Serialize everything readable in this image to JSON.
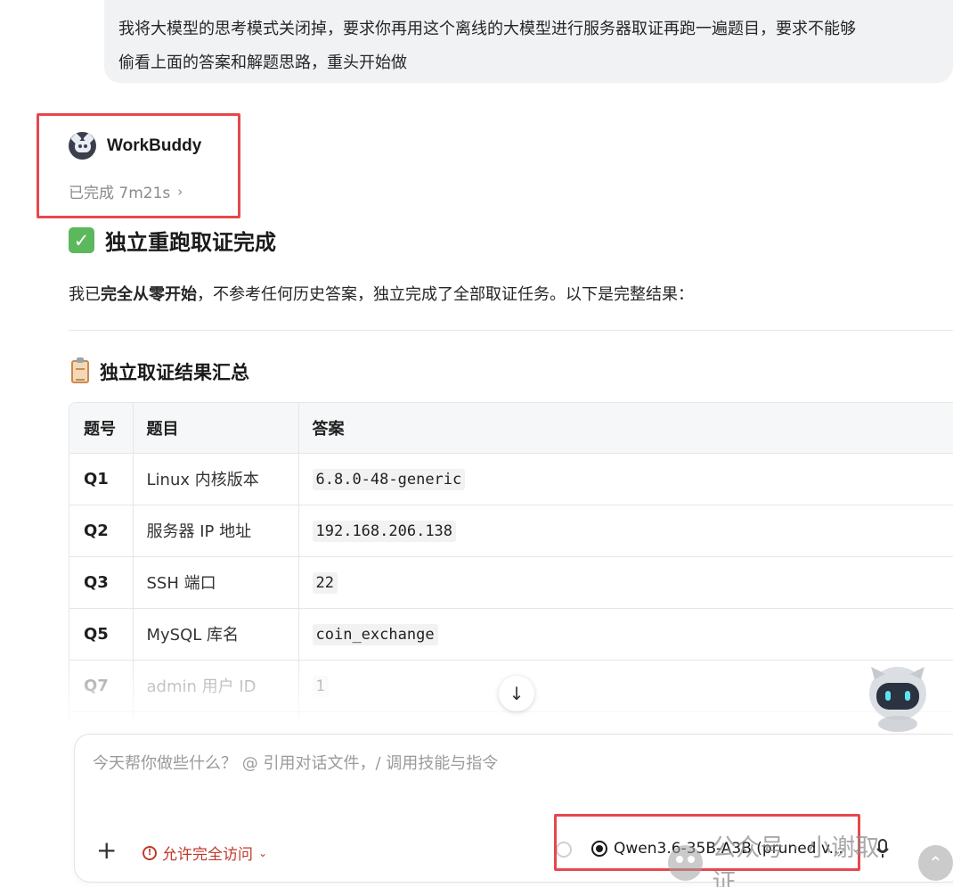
{
  "user_message": {
    "line1": "我将大模型的思考模式关闭掉，要求你再用这个离线的大模型进行服务器取证再跑一遍题目，要求不能够",
    "line2": "偷看上面的答案和解题思路，重头开始做"
  },
  "agent": {
    "name": "WorkBuddy",
    "status": "已完成 7m21s",
    "status_chevron": "›"
  },
  "response": {
    "heading": "独立重跑取证完成",
    "heading_icon": "check-mark-icon",
    "intro_prefix": "我已",
    "intro_bold": "完全从零开始",
    "intro_suffix": "，不参考任何历史答案，独立完成了全部取证任务。以下是完整结果：",
    "section_heading": "独立取证结果汇总",
    "section_icon": "clipboard-icon"
  },
  "table": {
    "headers": [
      "题号",
      "题目",
      "答案"
    ],
    "rows": [
      {
        "id": "Q1",
        "question": "Linux 内核版本",
        "answer": "6.8.0-48-generic"
      },
      {
        "id": "Q2",
        "question": "服务器 IP 地址",
        "answer": "192.168.206.138"
      },
      {
        "id": "Q3",
        "question": "SSH 端口",
        "answer": "22"
      },
      {
        "id": "Q5",
        "question": "MySQL 库名",
        "answer": "coin_exchange"
      },
      {
        "id": "Q7",
        "question": "admin 用户 ID",
        "answer": "1"
      }
    ]
  },
  "scroll_button": {
    "icon": "↓"
  },
  "composer": {
    "placeholder": "今天帮你做些什么？ @ 引用对话文件，/ 调用技能与指令",
    "add_icon": "+",
    "access_label": "允许完全访问",
    "access_chevron": "⌄",
    "model_label": "Qwen3.6-35B-A3B (pruned v...",
    "model_chevron": "⌄"
  },
  "watermark": {
    "text": "公众号 · 小谢取证",
    "up_icon": "⌃"
  },
  "colors": {
    "highlight_box": "#e5484d",
    "access_warning": "#c0392b",
    "check_green": "#5cb85c"
  }
}
